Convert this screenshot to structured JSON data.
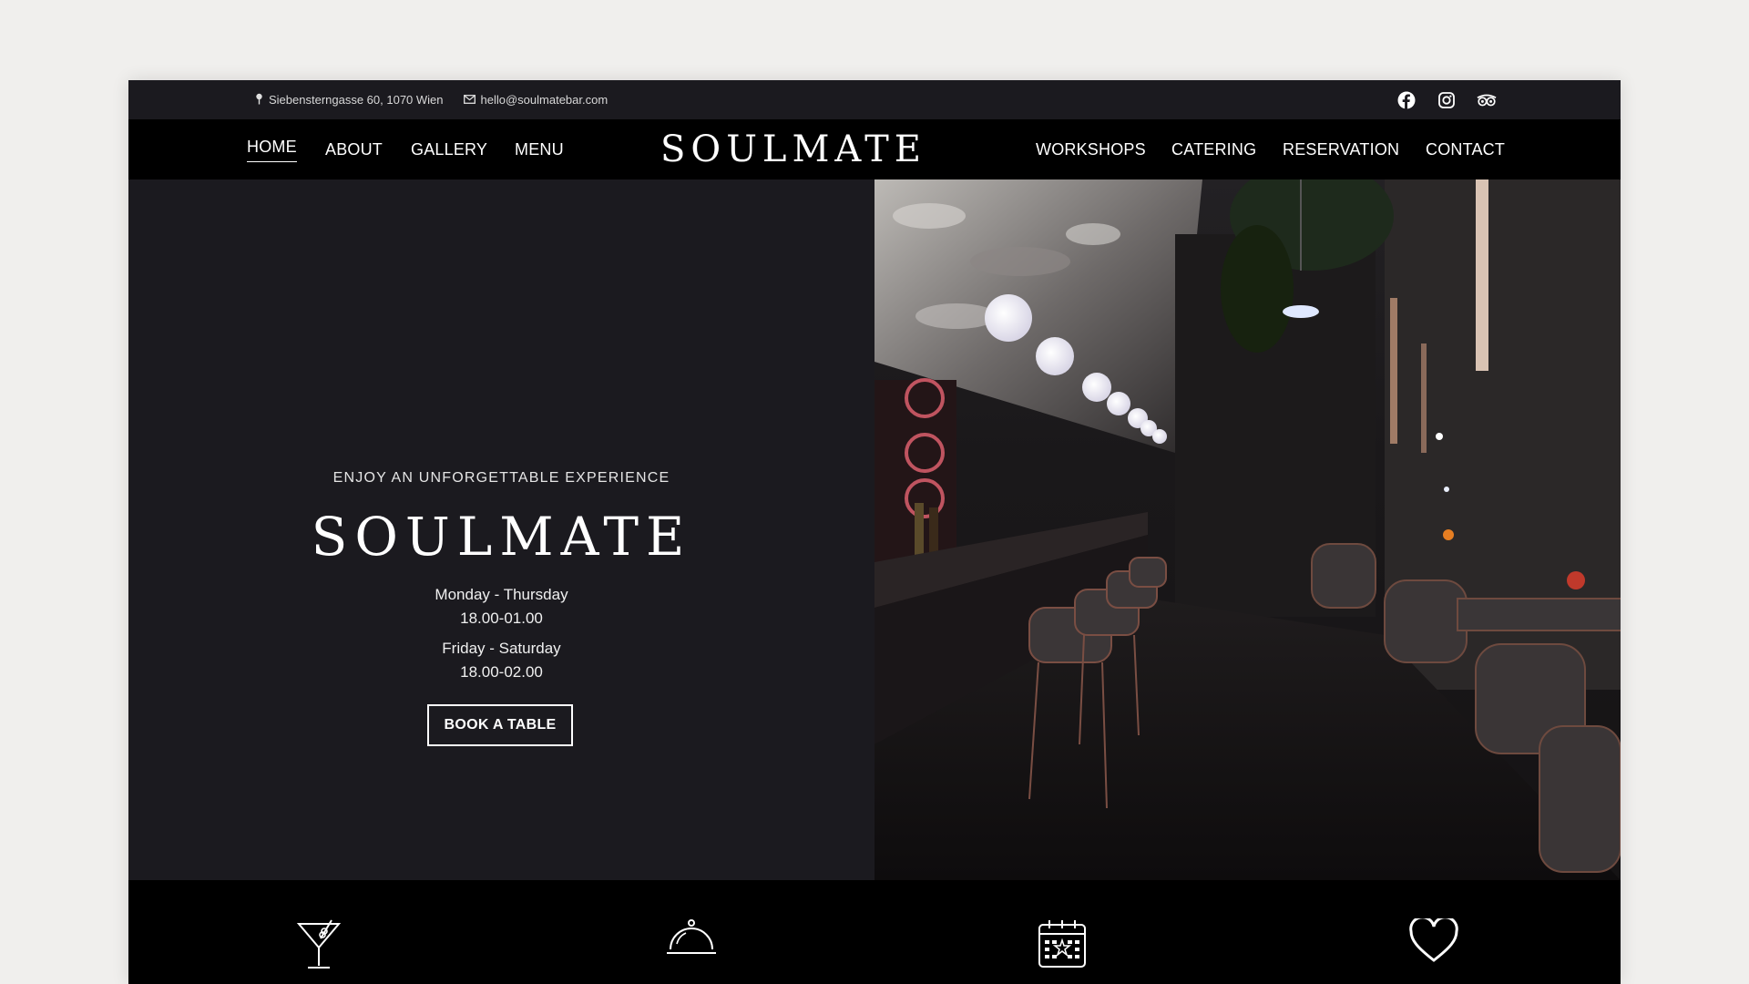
{
  "topbar": {
    "address": "Siebensterngasse 60, 1070 Wien",
    "email": "hello@soulmatebar.com",
    "social_icons": [
      "facebook-icon",
      "instagram-icon",
      "tripadvisor-icon"
    ]
  },
  "nav": {
    "left": [
      "HOME",
      "ABOUT",
      "GALLERY",
      "MENU"
    ],
    "right": [
      "WORKSHOPS",
      "CATERING",
      "RESERVATION",
      "CONTACT"
    ],
    "active": "HOME",
    "logo": "SOULMATE"
  },
  "hero": {
    "tagline": "ENJOY AN UNFORGETTABLE EXPERIENCE",
    "logo": "SOULMATE",
    "hours": [
      {
        "days": "Monday - Thursday",
        "time": "18.00-01.00"
      },
      {
        "days": "Friday - Saturday",
        "time": "18.00-02.00"
      }
    ],
    "cta": "BOOK A TABLE"
  },
  "features": {
    "icons": [
      "cocktail-icon",
      "cloche-icon",
      "calendar-icon",
      "heart-icon"
    ]
  },
  "colors": {
    "page_bg": "#f0efed",
    "topbar_bg": "#1b1a1f",
    "nav_bg": "#000000",
    "hero_left_bg": "#1b1a1f",
    "text": "#ffffff"
  }
}
